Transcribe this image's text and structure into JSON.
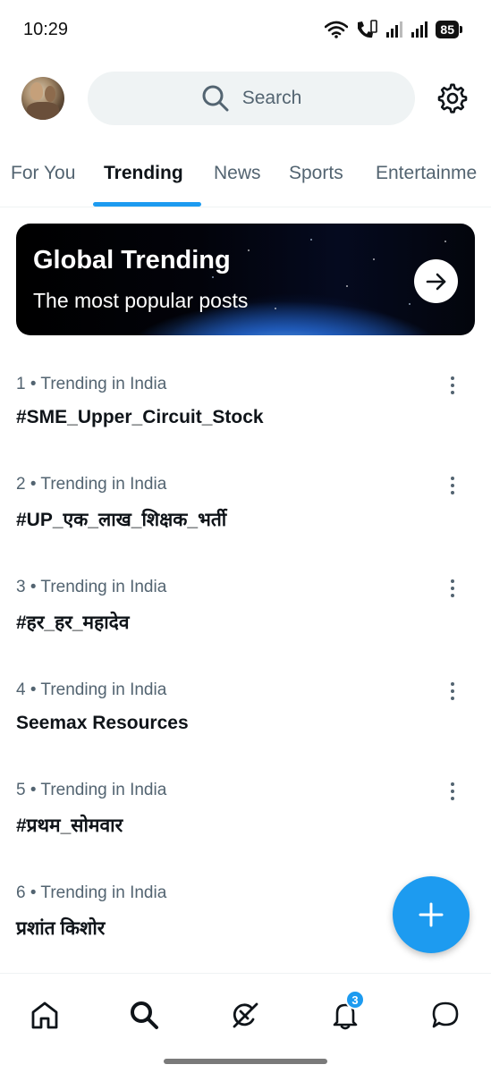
{
  "status_bar": {
    "time": "10:29",
    "battery": "85"
  },
  "header": {
    "search_placeholder": "Search"
  },
  "tabs": [
    {
      "label": "For You"
    },
    {
      "label": "Trending",
      "active": true
    },
    {
      "label": "News"
    },
    {
      "label": "Sports"
    },
    {
      "label": "Entertainme"
    }
  ],
  "banner": {
    "title": "Global Trending",
    "subtitle": "The most popular posts"
  },
  "trends": [
    {
      "meta": "1 • Trending in India",
      "name": "#SME_Upper_Circuit_Stock"
    },
    {
      "meta": "2 • Trending in India",
      "name": "#UP_एक_लाख_शिक्षक_भर्ती"
    },
    {
      "meta": "3 • Trending in India",
      "name": "#हर_हर_महादेव"
    },
    {
      "meta": "4 • Trending in India",
      "name": "Seemax Resources"
    },
    {
      "meta": "5 • Trending in India",
      "name": "#प्रथम_सोमवार"
    },
    {
      "meta": "6 • Trending in India",
      "name": "प्रशांत किशोर"
    }
  ],
  "bottom_nav": {
    "items": [
      "home-icon",
      "search-icon",
      "grok-icon",
      "notifications-icon",
      "messages-icon"
    ],
    "notifications_badge": "3"
  },
  "colors": {
    "accent": "#1d9bf0",
    "secondary_text": "#536471",
    "primary_text": "#0f1419"
  }
}
